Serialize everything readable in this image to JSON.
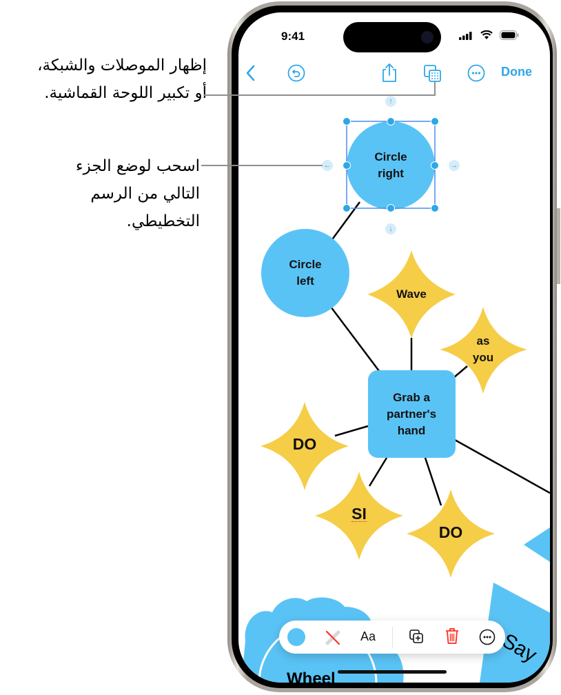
{
  "callouts": [
    {
      "lines": [
        "إظهار الموصلات والشبكة،",
        "أو تكبير اللوحة القماشية."
      ]
    },
    {
      "lines": [
        "اسحب لوضع الجزء",
        "التالي من الرسم",
        "التخطيطي."
      ]
    }
  ],
  "status_bar": {
    "time": "9:41"
  },
  "nav_bar": {
    "back": "chevron-left",
    "undo": "undo",
    "share": "share",
    "view_options": "grid-overlay",
    "more": "ellipsis",
    "done_label": "Done"
  },
  "diagram": {
    "nodes": [
      {
        "id": "circle-right",
        "shape": "circle",
        "label_lines": [
          "Circle",
          "right"
        ],
        "selected": true
      },
      {
        "id": "circle-left",
        "shape": "circle",
        "label_lines": [
          "Circle",
          "left"
        ]
      },
      {
        "id": "wave",
        "shape": "star",
        "label_lines": [
          "Wave"
        ]
      },
      {
        "id": "as-you",
        "shape": "star",
        "label_lines": [
          "as",
          "you"
        ]
      },
      {
        "id": "grab",
        "shape": "rounded-rect",
        "label_lines": [
          "Grab a",
          "partner's",
          "hand"
        ]
      },
      {
        "id": "do-1",
        "shape": "star",
        "label_lines": [
          "DO"
        ]
      },
      {
        "id": "si",
        "shape": "star",
        "label_lines": [
          "SI"
        ]
      },
      {
        "id": "do-2",
        "shape": "star",
        "label_lines": [
          "DO"
        ]
      },
      {
        "id": "wheel",
        "shape": "cloud",
        "label_lines": [
          "Wheel"
        ]
      },
      {
        "id": "say",
        "shape": "triangle",
        "label_lines": [
          "Say"
        ]
      }
    ],
    "colors": {
      "blue": "#5ac3f5",
      "yellow": "#f5cd47",
      "accent": "#2ea7e6",
      "delete": "#ff2d20"
    }
  },
  "toolbar": {
    "fill": "fill-color",
    "stroke": "no-stroke",
    "text_label": "Aa",
    "duplicate": "duplicate",
    "delete": "trash",
    "more": "ellipsis"
  }
}
